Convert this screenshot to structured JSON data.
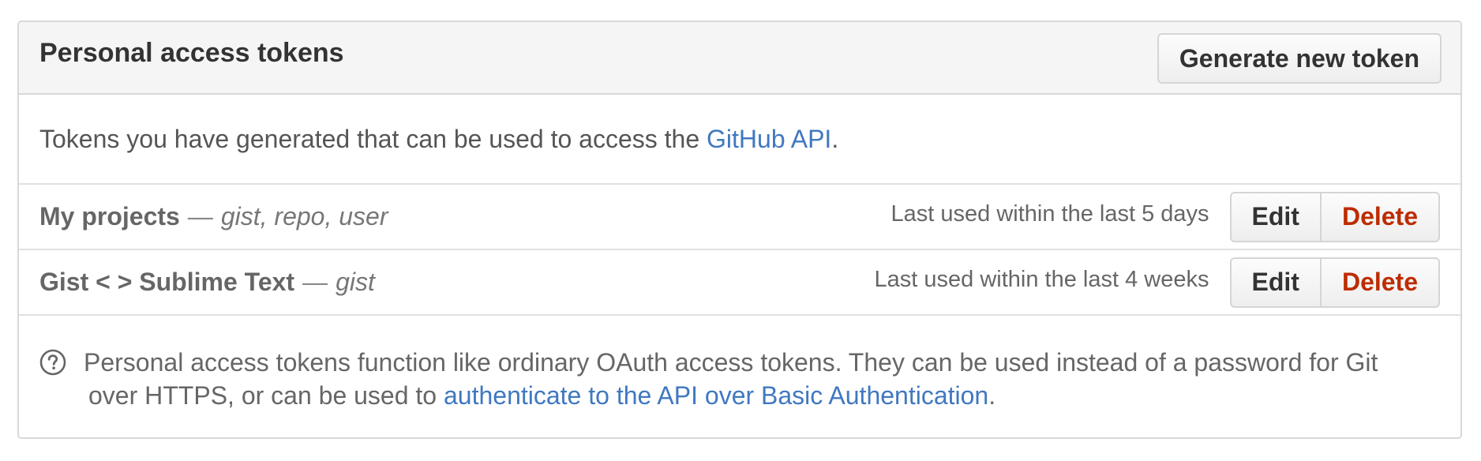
{
  "header": {
    "title": "Personal access tokens",
    "generate_button": "Generate new token"
  },
  "intro": {
    "text": "Tokens you have generated that can be used to access the ",
    "link": "GitHub API",
    "suffix": "."
  },
  "tokens": [
    {
      "name": "My projects",
      "dash": "—",
      "scopes": "gist, repo, user",
      "last_used": "Last used within the last 5 days",
      "edit_label": "Edit",
      "delete_label": "Delete"
    },
    {
      "name": "Gist < > Sublime Text",
      "dash": "—",
      "scopes": "gist",
      "last_used": "Last used within the last 4 weeks",
      "edit_label": "Edit",
      "delete_label": "Delete"
    }
  ],
  "help": {
    "icon": "question-circle-icon",
    "text_line1": "Personal access tokens function like ordinary OAuth access tokens. They can be used instead of a password for Git",
    "text_line2_prefix": "over HTTPS, or can be used to ",
    "link": "authenticate to the API over Basic Authentication",
    "suffix": "."
  },
  "colors": {
    "link": "#4078c0",
    "delete": "#bd2c00",
    "header_bg": "#f5f5f5",
    "border": "#d8d8d8"
  }
}
